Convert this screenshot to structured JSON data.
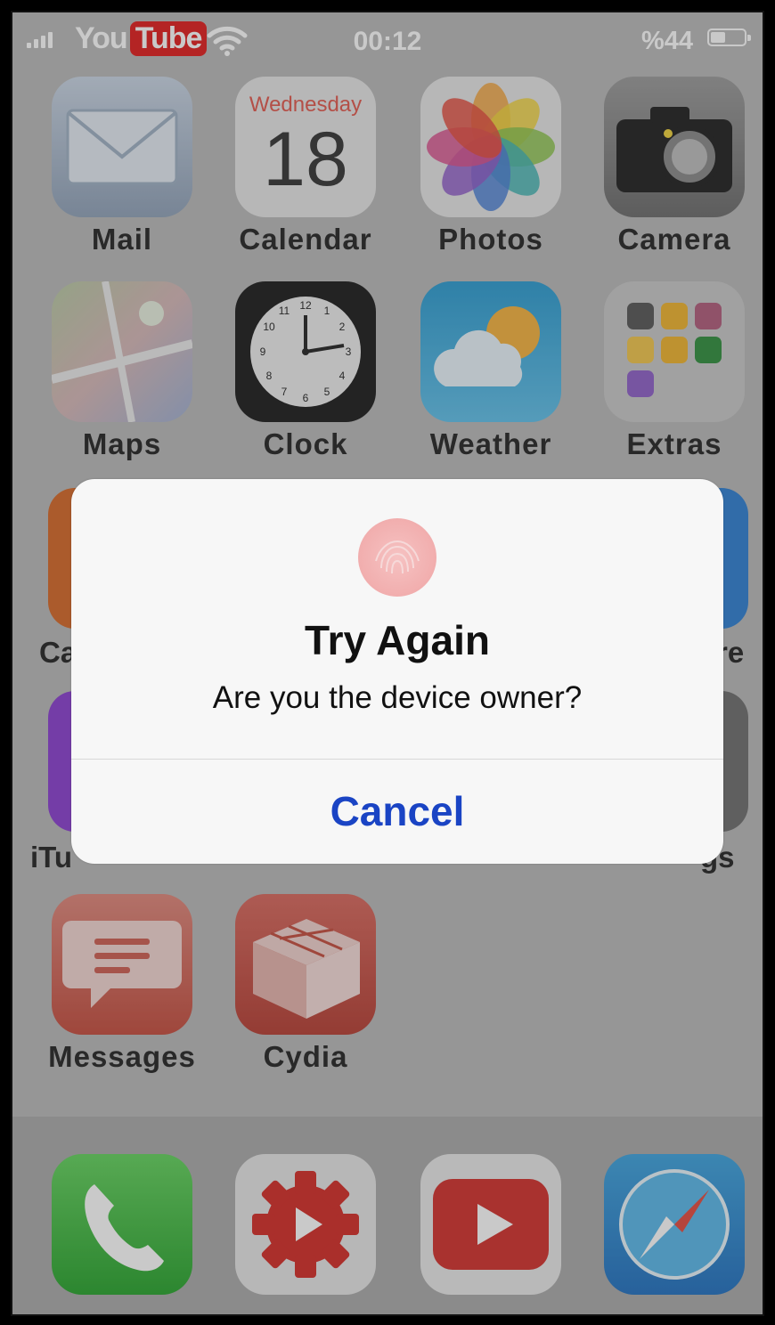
{
  "status_bar": {
    "yt_you": "You",
    "yt_tube": "Tube",
    "time": "00:12",
    "battery_percent": "%44",
    "battery_level": 0.44
  },
  "home_apps": [
    {
      "label": "Mail",
      "icon": "mail-icon"
    },
    {
      "label": "Calendar",
      "icon": "calendar-icon",
      "weekday": "Wednesday",
      "day": "18"
    },
    {
      "label": "Photos",
      "icon": "photos-icon"
    },
    {
      "label": "Camera",
      "icon": "camera-icon"
    },
    {
      "label": "Maps",
      "icon": "maps-icon"
    },
    {
      "label": "Clock",
      "icon": "clock-icon"
    },
    {
      "label": "Weather",
      "icon": "weather-icon"
    },
    {
      "label": "Extras",
      "icon": "folder-icon"
    },
    {
      "label": "Messages",
      "icon": "messages-icon"
    },
    {
      "label": "Cydia",
      "icon": "cydia-icon"
    }
  ],
  "dock": [
    "phone-icon",
    "youtube-studio-icon",
    "youtube-icon",
    "safari-icon"
  ],
  "alert": {
    "title": "Try Again",
    "message": "Are you the device owner?",
    "cancel_label": "Cancel"
  },
  "partial_labels": {
    "left_row3": "Ca",
    "right_row3": "re",
    "left_row4": "iTu",
    "right_row4": "gs"
  },
  "colors": {
    "accent_cancel": "#1a44c4",
    "youtube_red": "#e21b1b"
  }
}
